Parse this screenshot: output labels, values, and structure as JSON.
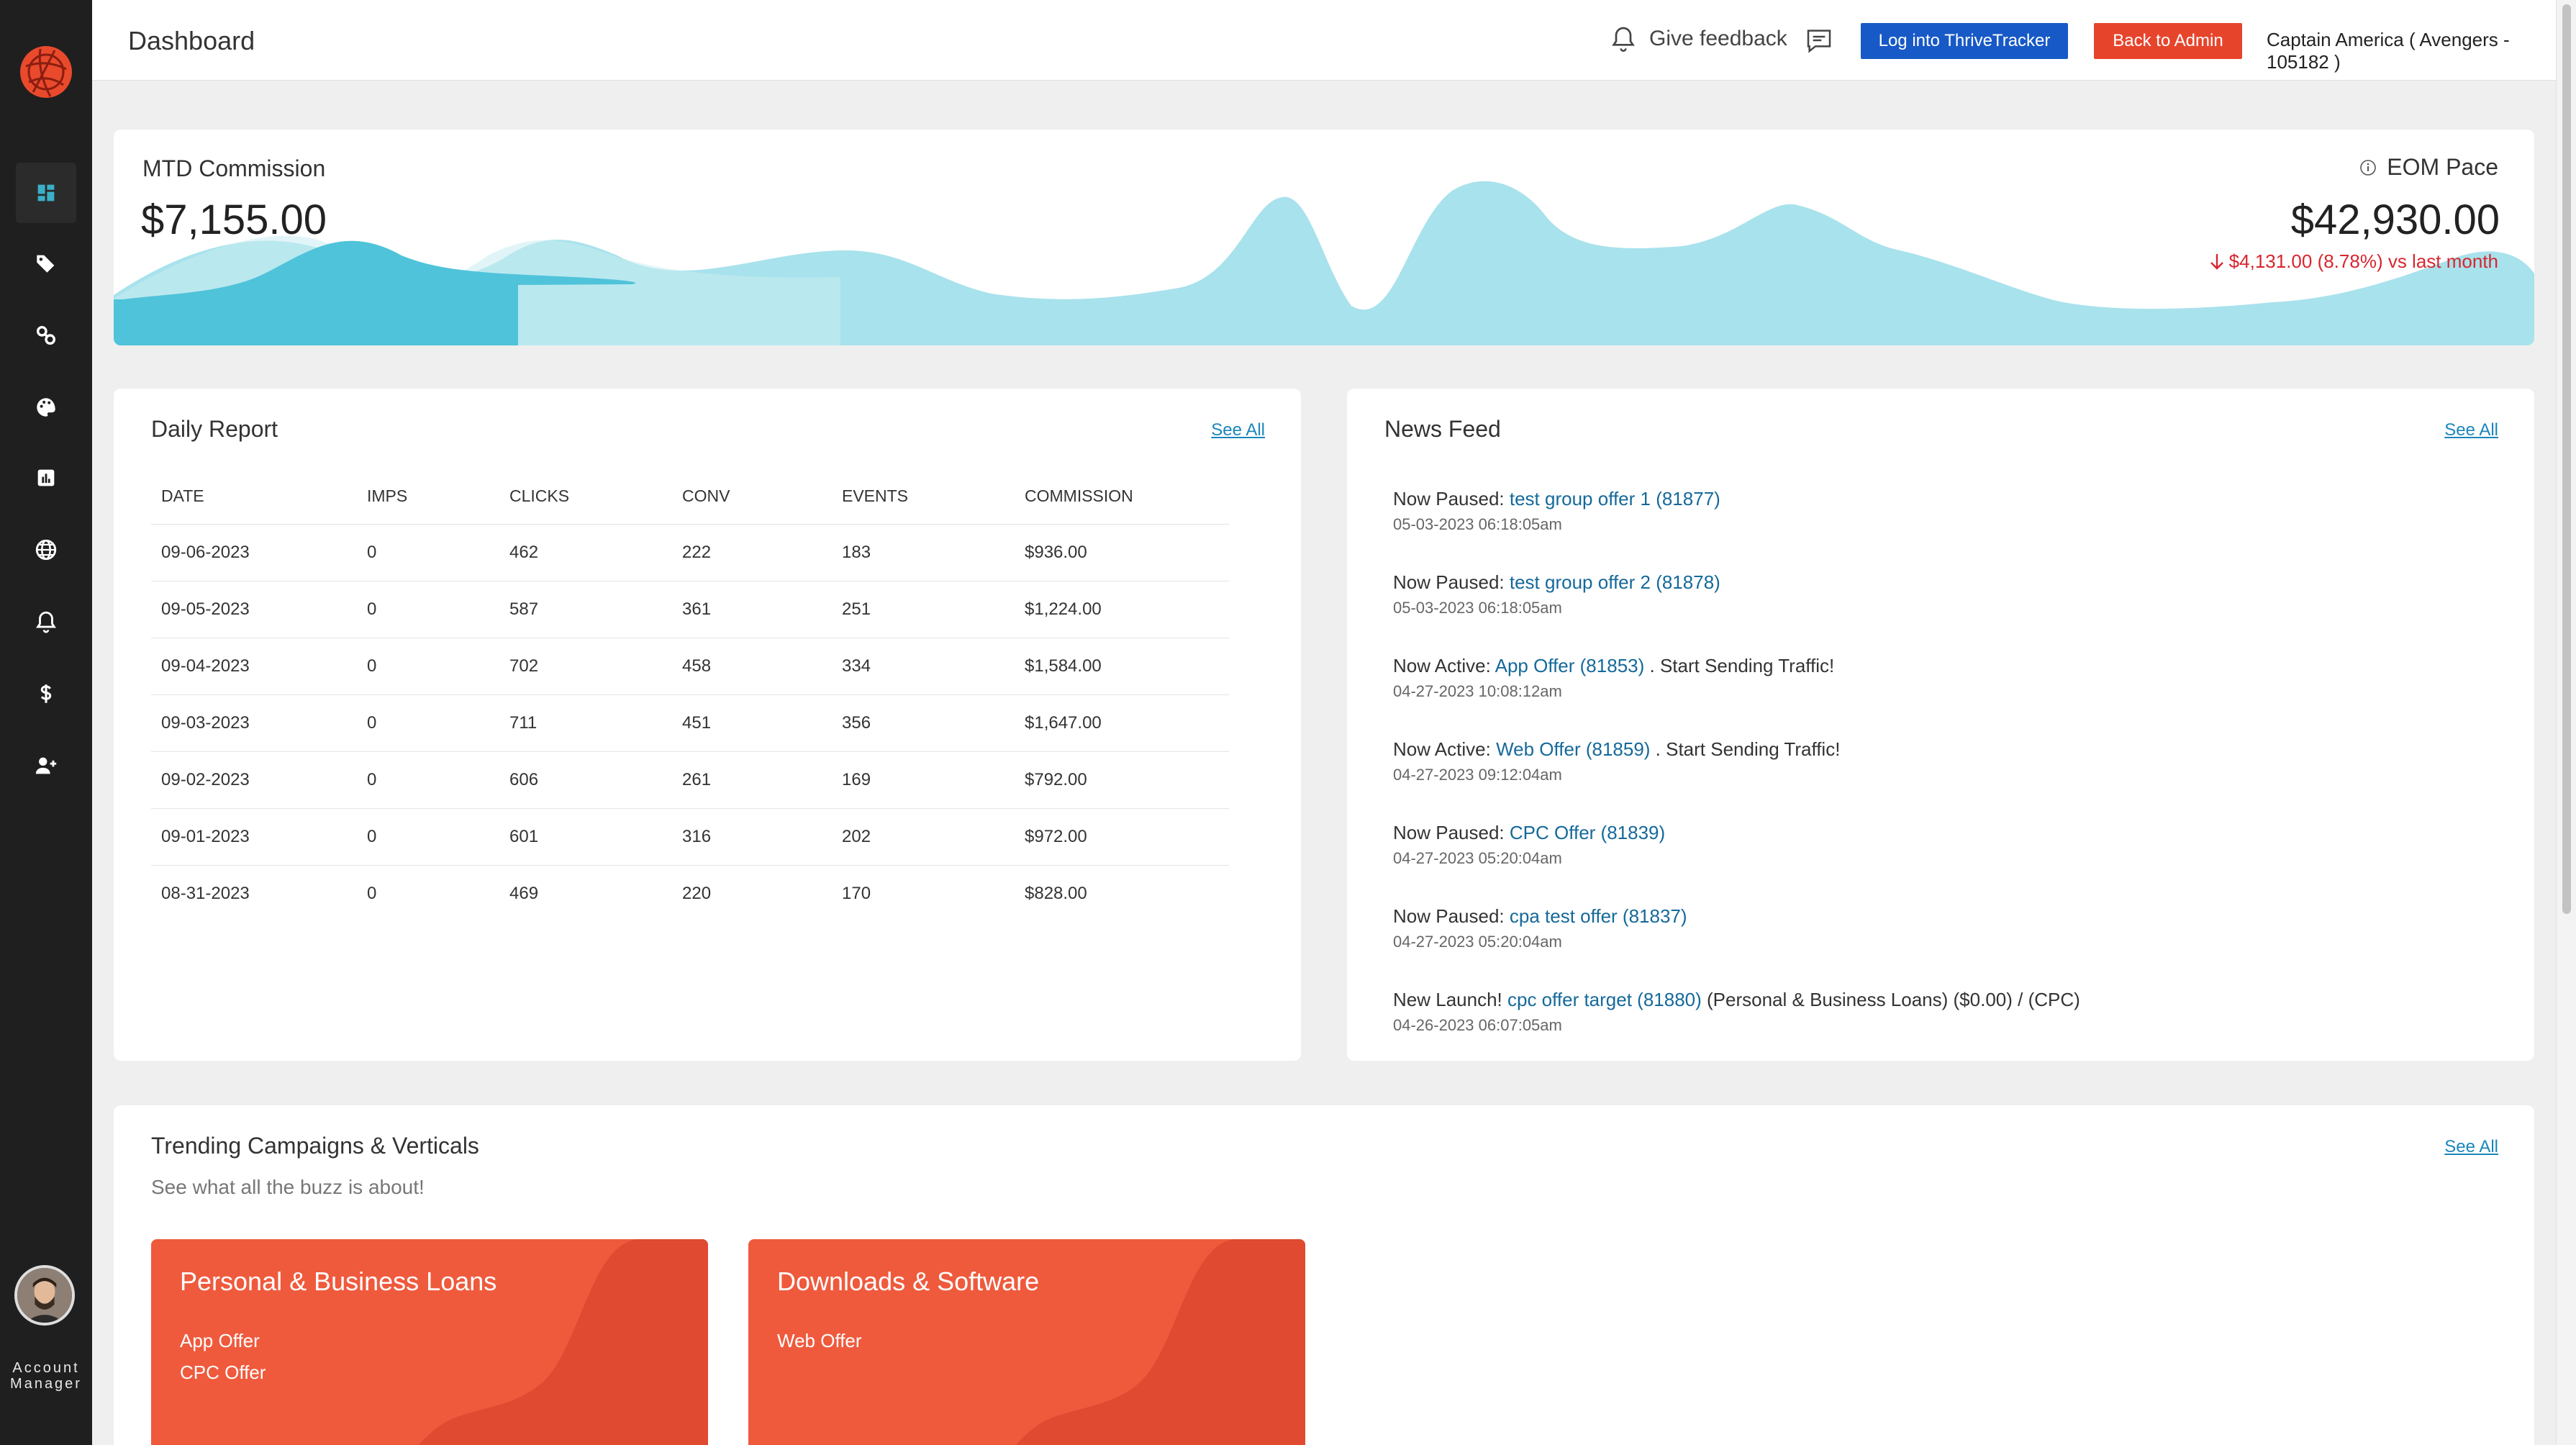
{
  "topbar": {
    "title": "Dashboard",
    "feedback_label": "Give feedback",
    "thrive_button": "Log into ThriveTracker",
    "admin_button": "Back to Admin",
    "user_label": "Captain America ( Avengers - 105182 )"
  },
  "sidebar": {
    "items": [
      "dashboard-icon",
      "tag-icon",
      "link-icon",
      "palette-icon",
      "reports-icon",
      "globe-icon",
      "bell-icon",
      "dollar-icon",
      "add-user-icon"
    ],
    "account_label_line1": "Account",
    "account_label_line2": "Manager"
  },
  "hero": {
    "mtd_label": "MTD Commission",
    "mtd_value": "$7,155.00",
    "eom_label": "EOM Pace",
    "eom_value": "$42,930.00",
    "eom_change": "$4,131.00 (8.78%) vs last month",
    "colors": {
      "wave_light": "#a8e2ec",
      "wave_dark": "#4fc3d9",
      "negative": "#d8262f"
    }
  },
  "daily": {
    "title": "Daily Report",
    "see_all": "See All",
    "headers": [
      "DATE",
      "IMPS",
      "CLICKS",
      "CONV",
      "EVENTS",
      "COMMISSION"
    ],
    "rows": [
      [
        "09-06-2023",
        "0",
        "462",
        "222",
        "183",
        "$936.00"
      ],
      [
        "09-05-2023",
        "0",
        "587",
        "361",
        "251",
        "$1,224.00"
      ],
      [
        "09-04-2023",
        "0",
        "702",
        "458",
        "334",
        "$1,584.00"
      ],
      [
        "09-03-2023",
        "0",
        "711",
        "451",
        "356",
        "$1,647.00"
      ],
      [
        "09-02-2023",
        "0",
        "606",
        "261",
        "169",
        "$792.00"
      ],
      [
        "09-01-2023",
        "0",
        "601",
        "316",
        "202",
        "$972.00"
      ],
      [
        "08-31-2023",
        "0",
        "469",
        "220",
        "170",
        "$828.00"
      ]
    ]
  },
  "news": {
    "title": "News Feed",
    "see_all": "See All",
    "items": [
      {
        "prefix": "Now Paused: ",
        "link": "test group offer 1 (81877)",
        "suffix": "",
        "time": "05-03-2023 06:18:05am"
      },
      {
        "prefix": "Now Paused: ",
        "link": "test group offer 2 (81878)",
        "suffix": "",
        "time": "05-03-2023 06:18:05am"
      },
      {
        "prefix": "Now Active: ",
        "link": "App Offer (81853)",
        "suffix": " . Start Sending Traffic!",
        "time": "04-27-2023 10:08:12am"
      },
      {
        "prefix": "Now Active: ",
        "link": "Web Offer (81859)",
        "suffix": " . Start Sending Traffic!",
        "time": "04-27-2023 09:12:04am"
      },
      {
        "prefix": "Now Paused: ",
        "link": "CPC Offer (81839)",
        "suffix": "",
        "time": "04-27-2023 05:20:04am"
      },
      {
        "prefix": "Now Paused: ",
        "link": "cpa test offer (81837)",
        "suffix": "",
        "time": "04-27-2023 05:20:04am"
      },
      {
        "prefix": "New Launch! ",
        "link": "cpc offer target (81880)",
        "suffix": " (Personal & Business Loans) ($0.00) / (CPC)",
        "time": "04-26-2023 06:07:05am"
      }
    ]
  },
  "trending": {
    "title": "Trending Campaigns & Verticals",
    "subtitle": "See what all the buzz is about!",
    "see_all": "See All",
    "tiles": [
      {
        "title": "Personal & Business Loans",
        "offers": [
          "App Offer",
          "CPC Offer"
        ]
      },
      {
        "title": "Downloads & Software",
        "offers": [
          "Web Offer"
        ]
      }
    ],
    "colors": {
      "tile": "#ef5a3d",
      "tile_shade": "#e04a31"
    }
  }
}
